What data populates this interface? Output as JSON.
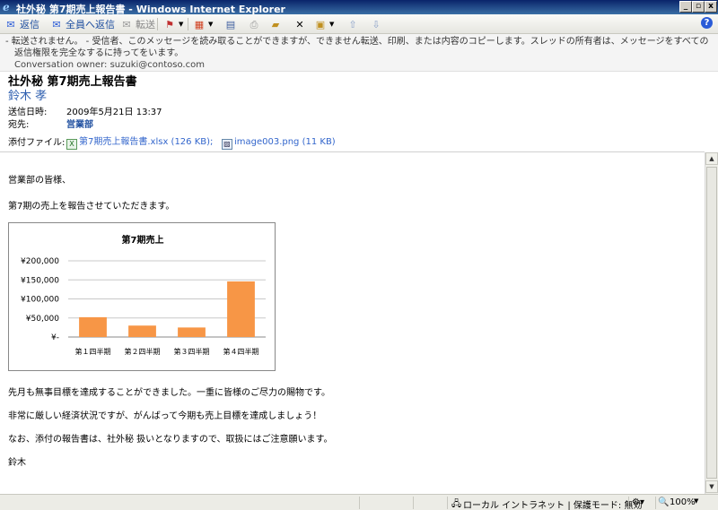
{
  "window": {
    "title": "社外秘 第7期売上報告書 - Windows Internet Explorer"
  },
  "toolbar": {
    "reply": "返信",
    "reply_all": "全員へ返信",
    "forward": "転送"
  },
  "infobar": {
    "line1": "- 転送されません。 - 受信者、このメッセージを読み取ることができますが、できません転送、印刷、または内容のコピーします。スレッドの所有者は、メッセージをすべての",
    "line2": "返信権限を完全なするに持ってをいます。",
    "owner": "Conversation owner: suzuki@contoso.com"
  },
  "message": {
    "subject": "社外秘 第7期売上報告書",
    "sender": "鈴木 孝",
    "sent_label": "送信日時:",
    "sent_value": "2009年5月21日 13:37",
    "to_label": "宛先:",
    "to_value": "営業部",
    "attach_label": "添付ファイル:",
    "attachments": [
      {
        "name": "第7期売上報告書.xlsx (126 KB);"
      },
      {
        "name": "image003.png (11 KB)"
      }
    ]
  },
  "body": {
    "greeting": "営業部の皆様、",
    "intro": "第7期の売上を報告させていただきます。",
    "p1": "先月も無事目標を達成することができました。一重に皆様のご尽力の賜物です。",
    "p2": "非常に厳しい経済状況ですが、がんばって今期も売上目標を達成しましょう！",
    "p3": "なお、添付の報告書は、社外秘 扱いとなりますので、取扱にはご注意願います。",
    "sign": "鈴木"
  },
  "chart_data": {
    "type": "bar",
    "title": "第7期売上",
    "categories": [
      "第１四半期",
      "第２四半期",
      "第３四半期",
      "第４四半期"
    ],
    "values": [
      52000,
      30000,
      25000,
      146000
    ],
    "ylim": [
      0,
      200000
    ],
    "yticks": [
      "¥-",
      "¥50,000",
      "¥100,000",
      "¥150,000",
      "¥200,000"
    ],
    "bar_color": "#f79646",
    "grid": true
  },
  "statusbar": {
    "zone": "ローカル イントラネット | 保護モード: 無効",
    "zoom": "100%"
  }
}
